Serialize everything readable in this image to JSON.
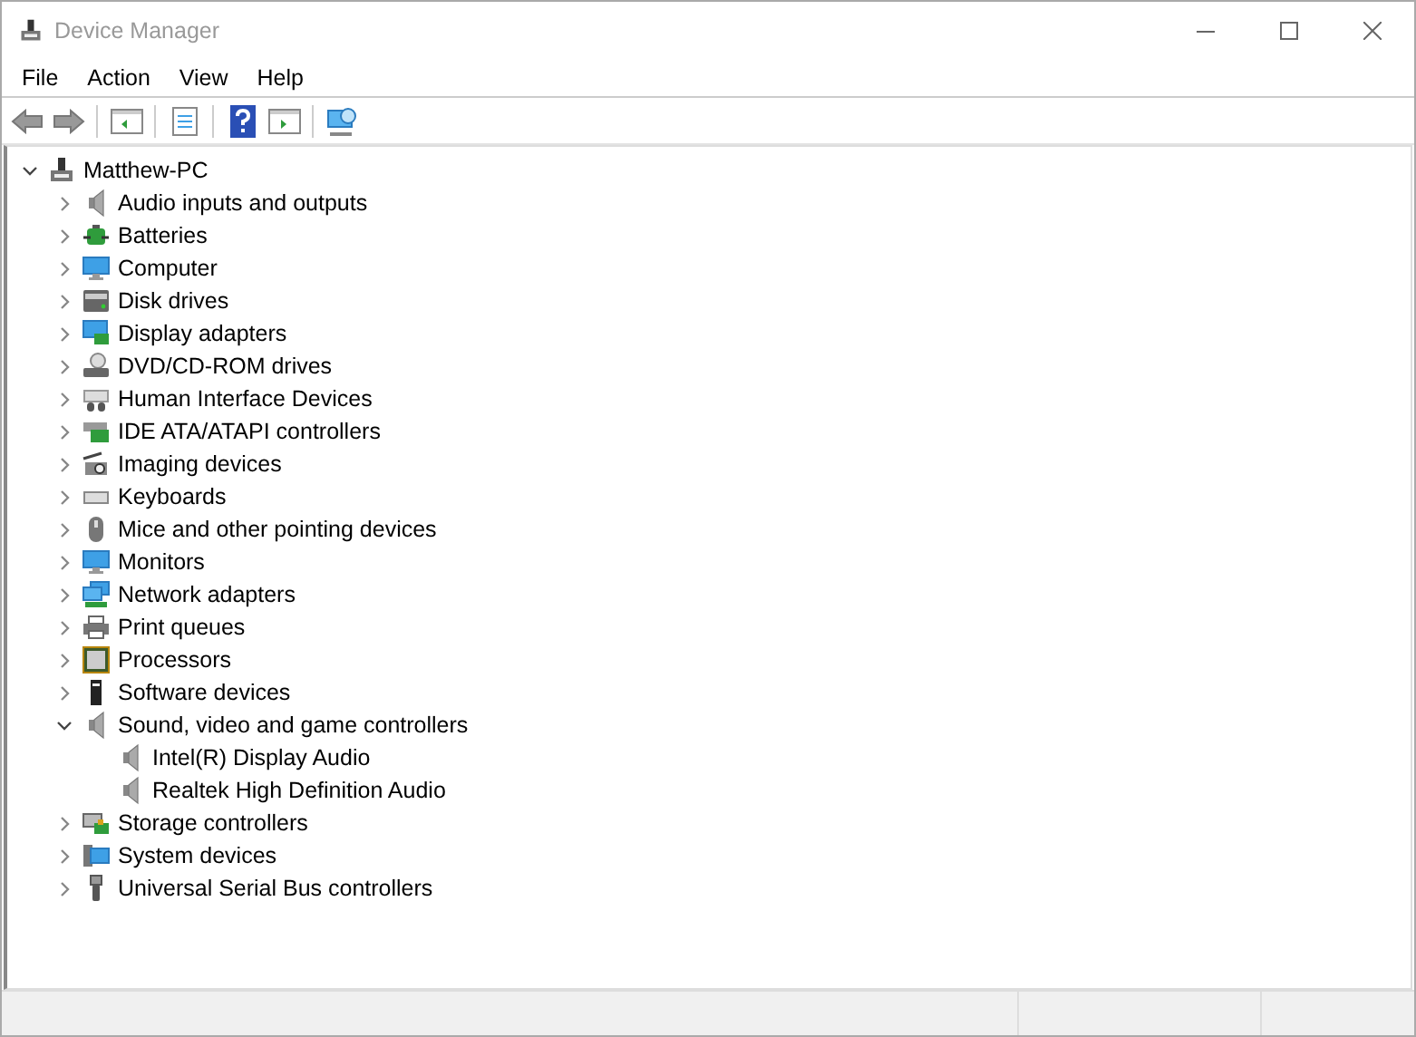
{
  "window": {
    "title": "Device Manager"
  },
  "menu": [
    "File",
    "Action",
    "View",
    "Help"
  ],
  "tree": [
    {
      "label": "Matthew-PC",
      "kind": "pc",
      "expanded": true,
      "children": [
        {
          "label": "Audio inputs and outputs",
          "kind": "speaker",
          "expanded": false
        },
        {
          "label": "Batteries",
          "kind": "battery",
          "expanded": false
        },
        {
          "label": "Computer",
          "kind": "monitor",
          "expanded": false
        },
        {
          "label": "Disk drives",
          "kind": "disk",
          "expanded": false
        },
        {
          "label": "Display adapters",
          "kind": "display",
          "expanded": false
        },
        {
          "label": "DVD/CD-ROM drives",
          "kind": "optical",
          "expanded": false
        },
        {
          "label": "Human Interface Devices",
          "kind": "hid",
          "expanded": false
        },
        {
          "label": "IDE ATA/ATAPI controllers",
          "kind": "ide",
          "expanded": false
        },
        {
          "label": "Imaging devices",
          "kind": "camera",
          "expanded": false
        },
        {
          "label": "Keyboards",
          "kind": "keyboard",
          "expanded": false
        },
        {
          "label": "Mice and other pointing devices",
          "kind": "mouse",
          "expanded": false
        },
        {
          "label": "Monitors",
          "kind": "monitor",
          "expanded": false
        },
        {
          "label": "Network adapters",
          "kind": "network",
          "expanded": false
        },
        {
          "label": "Print queues",
          "kind": "printer",
          "expanded": false
        },
        {
          "label": "Processors",
          "kind": "cpu",
          "expanded": false
        },
        {
          "label": "Software devices",
          "kind": "tower",
          "expanded": false
        },
        {
          "label": "Sound, video and game controllers",
          "kind": "speaker",
          "expanded": true,
          "children": [
            {
              "label": "Intel(R) Display Audio",
              "kind": "speaker"
            },
            {
              "label": "Realtek High Definition Audio",
              "kind": "speaker"
            }
          ]
        },
        {
          "label": "Storage controllers",
          "kind": "storage",
          "expanded": false
        },
        {
          "label": "System devices",
          "kind": "system",
          "expanded": false
        },
        {
          "label": "Universal Serial Bus controllers",
          "kind": "usb",
          "expanded": false
        }
      ]
    }
  ]
}
